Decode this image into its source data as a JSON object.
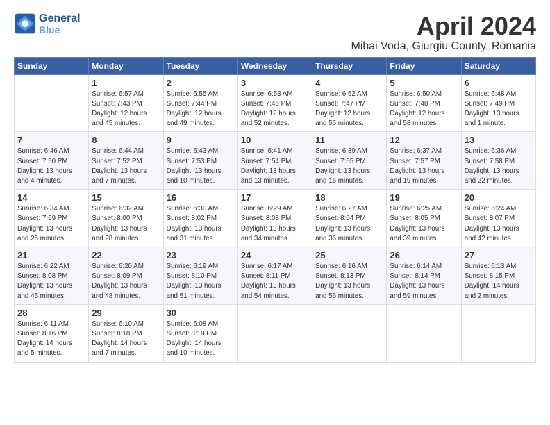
{
  "logo": {
    "line1": "General",
    "line2": "Blue"
  },
  "title": "April 2024",
  "subtitle": "Mihai Voda, Giurgiu County, Romania",
  "weekdays": [
    "Sunday",
    "Monday",
    "Tuesday",
    "Wednesday",
    "Thursday",
    "Friday",
    "Saturday"
  ],
  "weeks": [
    [
      {
        "day": "",
        "info": ""
      },
      {
        "day": "1",
        "info": "Sunrise: 6:57 AM\nSunset: 7:43 PM\nDaylight: 12 hours\nand 45 minutes."
      },
      {
        "day": "2",
        "info": "Sunrise: 6:55 AM\nSunset: 7:44 PM\nDaylight: 12 hours\nand 49 minutes."
      },
      {
        "day": "3",
        "info": "Sunrise: 6:53 AM\nSunset: 7:46 PM\nDaylight: 12 hours\nand 52 minutes."
      },
      {
        "day": "4",
        "info": "Sunrise: 6:52 AM\nSunset: 7:47 PM\nDaylight: 12 hours\nand 55 minutes."
      },
      {
        "day": "5",
        "info": "Sunrise: 6:50 AM\nSunset: 7:48 PM\nDaylight: 12 hours\nand 58 minutes."
      },
      {
        "day": "6",
        "info": "Sunrise: 6:48 AM\nSunset: 7:49 PM\nDaylight: 13 hours\nand 1 minute."
      }
    ],
    [
      {
        "day": "7",
        "info": "Sunrise: 6:46 AM\nSunset: 7:50 PM\nDaylight: 13 hours\nand 4 minutes."
      },
      {
        "day": "8",
        "info": "Sunrise: 6:44 AM\nSunset: 7:52 PM\nDaylight: 13 hours\nand 7 minutes."
      },
      {
        "day": "9",
        "info": "Sunrise: 6:43 AM\nSunset: 7:53 PM\nDaylight: 13 hours\nand 10 minutes."
      },
      {
        "day": "10",
        "info": "Sunrise: 6:41 AM\nSunset: 7:54 PM\nDaylight: 13 hours\nand 13 minutes."
      },
      {
        "day": "11",
        "info": "Sunrise: 6:39 AM\nSunset: 7:55 PM\nDaylight: 13 hours\nand 16 minutes."
      },
      {
        "day": "12",
        "info": "Sunrise: 6:37 AM\nSunset: 7:57 PM\nDaylight: 13 hours\nand 19 minutes."
      },
      {
        "day": "13",
        "info": "Sunrise: 6:36 AM\nSunset: 7:58 PM\nDaylight: 13 hours\nand 22 minutes."
      }
    ],
    [
      {
        "day": "14",
        "info": "Sunrise: 6:34 AM\nSunset: 7:59 PM\nDaylight: 13 hours\nand 25 minutes."
      },
      {
        "day": "15",
        "info": "Sunrise: 6:32 AM\nSunset: 8:00 PM\nDaylight: 13 hours\nand 28 minutes."
      },
      {
        "day": "16",
        "info": "Sunrise: 6:30 AM\nSunset: 8:02 PM\nDaylight: 13 hours\nand 31 minutes."
      },
      {
        "day": "17",
        "info": "Sunrise: 6:29 AM\nSunset: 8:03 PM\nDaylight: 13 hours\nand 34 minutes."
      },
      {
        "day": "18",
        "info": "Sunrise: 6:27 AM\nSunset: 8:04 PM\nDaylight: 13 hours\nand 36 minutes."
      },
      {
        "day": "19",
        "info": "Sunrise: 6:25 AM\nSunset: 8:05 PM\nDaylight: 13 hours\nand 39 minutes."
      },
      {
        "day": "20",
        "info": "Sunrise: 6:24 AM\nSunset: 8:07 PM\nDaylight: 13 hours\nand 42 minutes."
      }
    ],
    [
      {
        "day": "21",
        "info": "Sunrise: 6:22 AM\nSunset: 8:08 PM\nDaylight: 13 hours\nand 45 minutes."
      },
      {
        "day": "22",
        "info": "Sunrise: 6:20 AM\nSunset: 8:09 PM\nDaylight: 13 hours\nand 48 minutes."
      },
      {
        "day": "23",
        "info": "Sunrise: 6:19 AM\nSunset: 8:10 PM\nDaylight: 13 hours\nand 51 minutes."
      },
      {
        "day": "24",
        "info": "Sunrise: 6:17 AM\nSunset: 8:11 PM\nDaylight: 13 hours\nand 54 minutes."
      },
      {
        "day": "25",
        "info": "Sunrise: 6:16 AM\nSunset: 8:13 PM\nDaylight: 13 hours\nand 56 minutes."
      },
      {
        "day": "26",
        "info": "Sunrise: 6:14 AM\nSunset: 8:14 PM\nDaylight: 13 hours\nand 59 minutes."
      },
      {
        "day": "27",
        "info": "Sunrise: 6:13 AM\nSunset: 8:15 PM\nDaylight: 14 hours\nand 2 minutes."
      }
    ],
    [
      {
        "day": "28",
        "info": "Sunrise: 6:11 AM\nSunset: 8:16 PM\nDaylight: 14 hours\nand 5 minutes."
      },
      {
        "day": "29",
        "info": "Sunrise: 6:10 AM\nSunset: 8:18 PM\nDaylight: 14 hours\nand 7 minutes."
      },
      {
        "day": "30",
        "info": "Sunrise: 6:08 AM\nSunset: 8:19 PM\nDaylight: 14 hours\nand 10 minutes."
      },
      {
        "day": "",
        "info": ""
      },
      {
        "day": "",
        "info": ""
      },
      {
        "day": "",
        "info": ""
      },
      {
        "day": "",
        "info": ""
      }
    ]
  ]
}
